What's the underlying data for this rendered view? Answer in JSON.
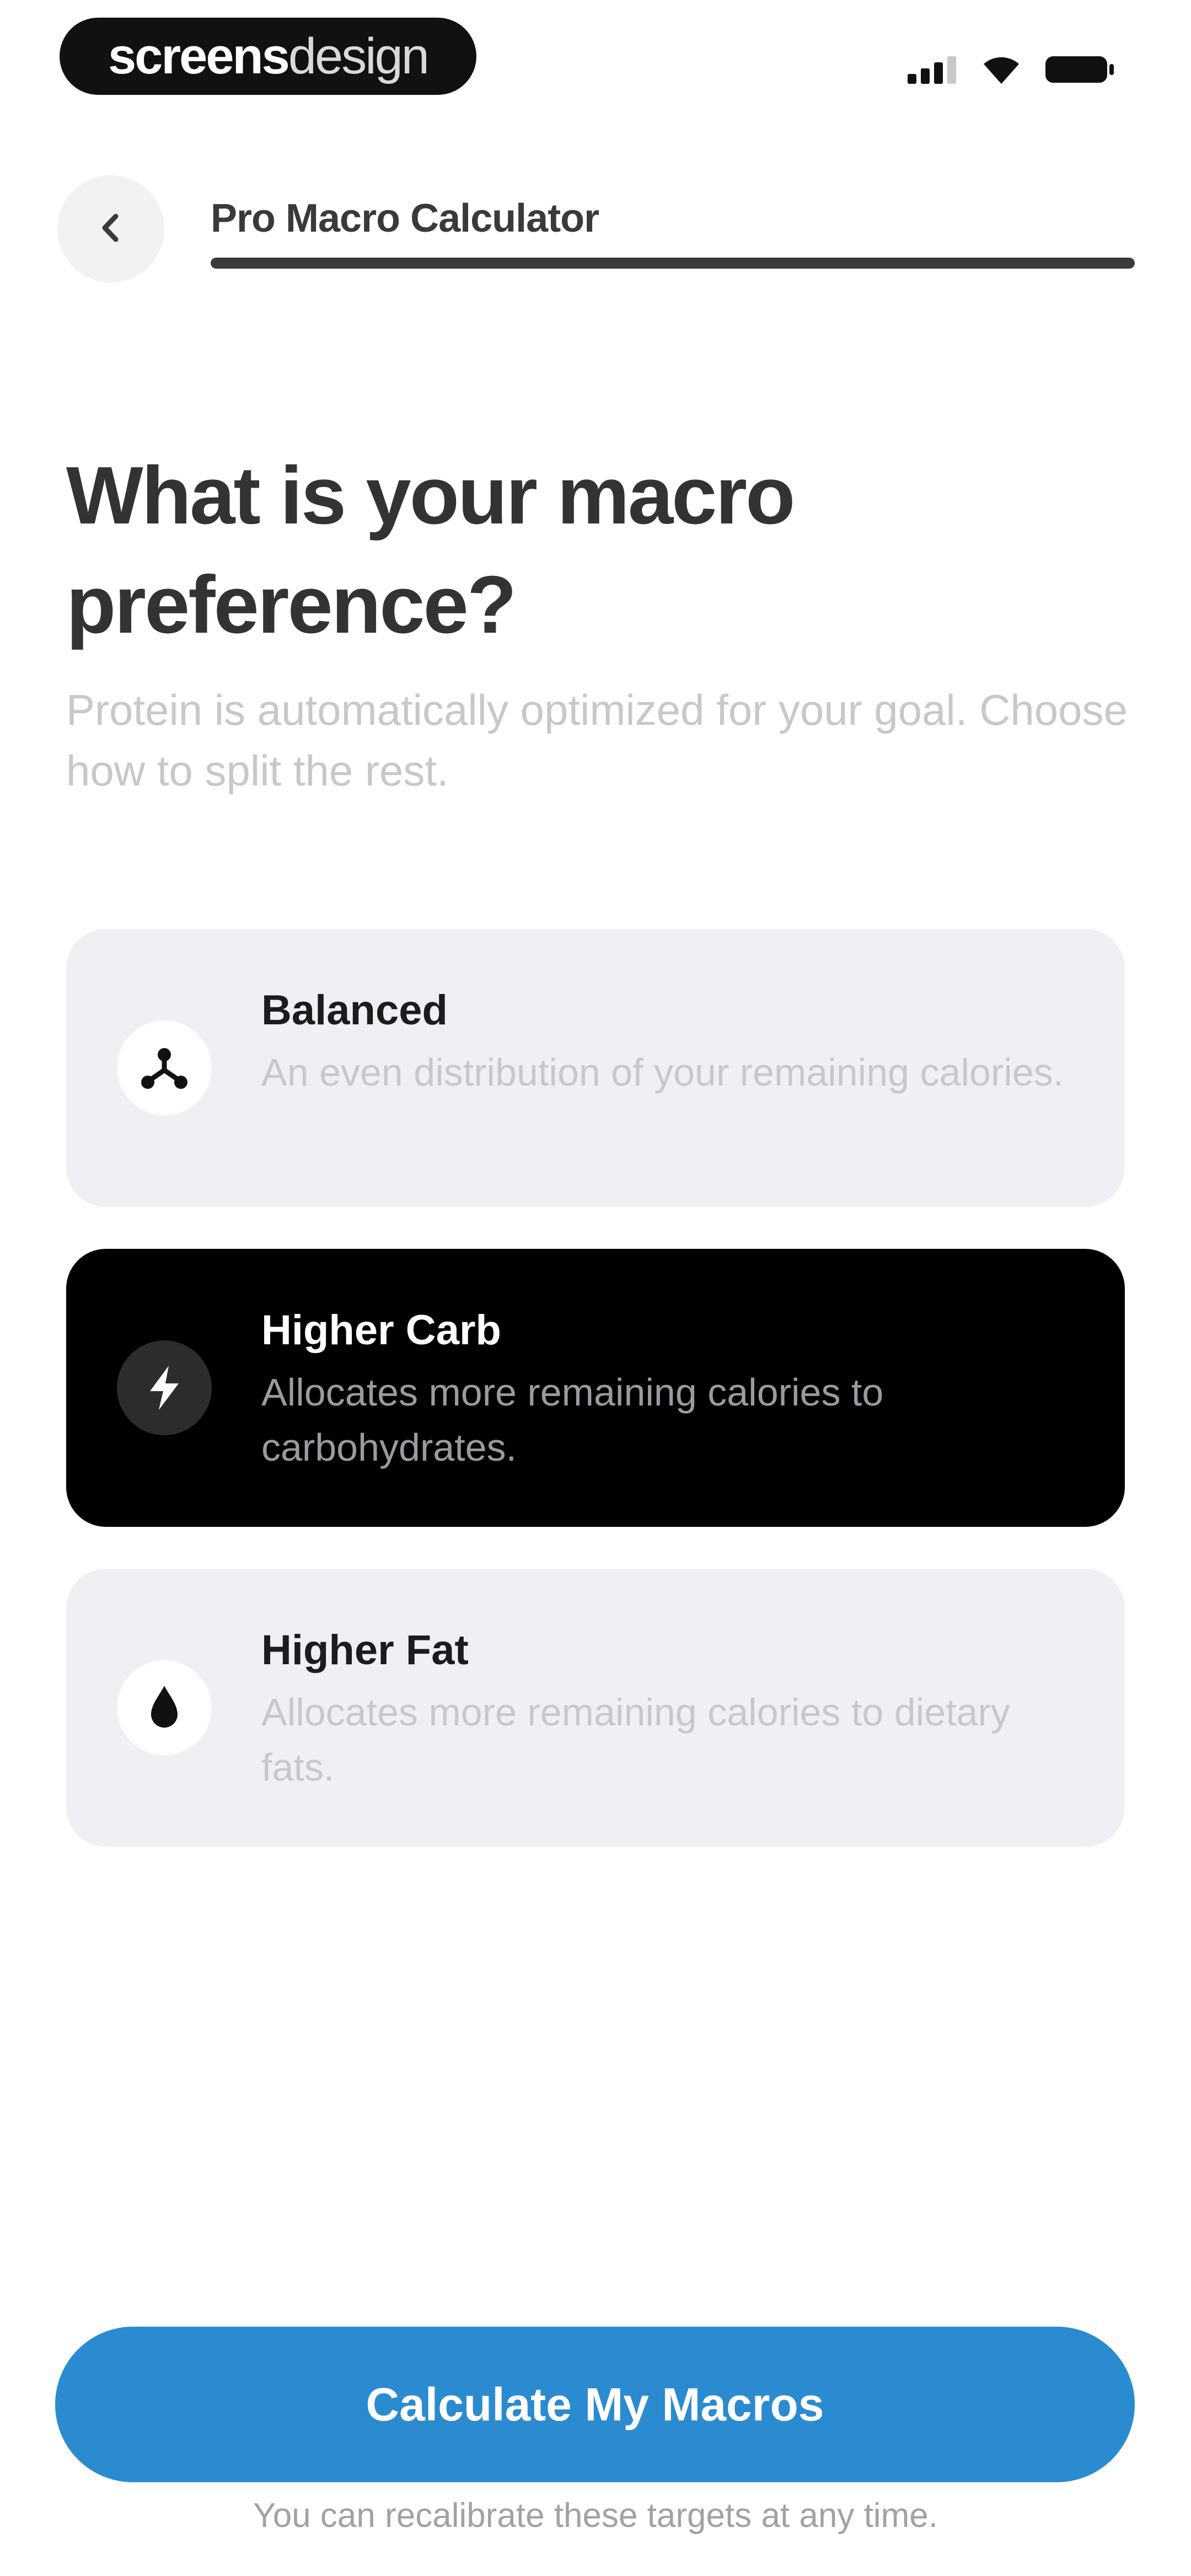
{
  "status_bar": {
    "brand_part1": "screens",
    "brand_part2": "design",
    "icons": [
      "cellular-signal-icon",
      "wifi-icon",
      "battery-icon"
    ]
  },
  "nav": {
    "back_icon": "chevron-left-icon",
    "title": "Pro Macro Calculator",
    "progress": 1.0
  },
  "question": {
    "title": "What is your macro preference?",
    "subtitle": "Protein is automatically optimized for your goal. Choose how to split the rest."
  },
  "options": [
    {
      "id": "balanced",
      "icon": "balance-nodes-icon",
      "title": "Balanced",
      "description": "An even distribution of your remaining calories.",
      "selected": false
    },
    {
      "id": "higher-carb",
      "icon": "lightning-bolt-icon",
      "title": "Higher Carb",
      "description": "Allocates more remaining calories to carbohydrates.",
      "selected": true
    },
    {
      "id": "higher-fat",
      "icon": "droplet-icon",
      "title": "Higher Fat",
      "description": "Allocates more remaining calories to dietary fats.",
      "selected": false
    }
  ],
  "footer": {
    "cta_label": "Calculate My Macros",
    "note": "You can recalibrate these targets at any time."
  },
  "colors": {
    "accent": "#2a8bd0",
    "selected_card": "#000000",
    "card": "#f0f0f4",
    "text_primary": "#1c1c1e",
    "text_secondary": "#c7c7cc"
  }
}
